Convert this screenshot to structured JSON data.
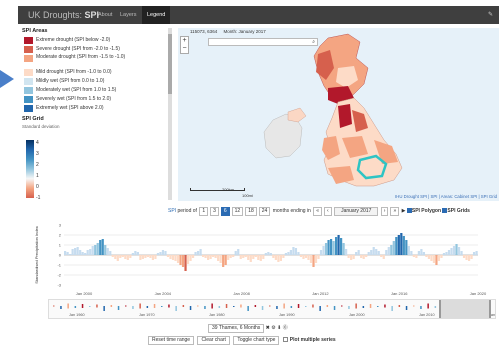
{
  "app": {
    "brand_prefix": "UK Droughts:",
    "brand_bold": "SPI"
  },
  "nav": {
    "items": [
      "About",
      "Layers",
      "Legend"
    ],
    "active": "Legend"
  },
  "legend": {
    "areas_title": "SPI Areas",
    "areas": [
      {
        "label": "Extreme drought (SPI below -2.0)",
        "color": "#b2182b"
      },
      {
        "label": "Severe drought (SPI from -2.0 to -1.5)",
        "color": "#d6604d"
      },
      {
        "label": "Moderate drought (SPI from -1.5 to -1.0)",
        "color": "#f4a582",
        "tall": true
      },
      {
        "label": "Mild drought (SPI from -1.0 to 0.0)",
        "color": "#fddbc7"
      },
      {
        "label": "Mildly wet (SPI from 0.0 to 1.0)",
        "color": "#d1e5f0"
      },
      {
        "label": "Moderately wet (SPI from 1.0 to 1.5)",
        "color": "#92c5de"
      },
      {
        "label": "Severely wet (SPI from 1.5 to 2.0)",
        "color": "#4393c3"
      },
      {
        "label": "Extremely wet (SPI above 2.0)",
        "color": "#2166ac"
      }
    ],
    "grid_title": "SPI Grid",
    "grid_subtitle": "Standard deviation",
    "grid_ticks": [
      "4",
      "3",
      "2",
      "1",
      "0",
      "-1"
    ]
  },
  "map": {
    "coords": "115073, 6364",
    "period": "Month: January 2017",
    "zoom_in": "+",
    "zoom_out": "−",
    "search_icon": "search-icon",
    "scale_top": "200km",
    "scale_bottom": "100mi",
    "attribution": "IHU Drought SPI | SPI | Areas: Cabinet SPI | SPI Grid"
  },
  "controls": {
    "spi_label": "SPI",
    "period_label": "period of",
    "periods": [
      "1",
      "3",
      "6",
      "12",
      "18",
      "24"
    ],
    "active_period": "6",
    "months_label": "months ending in",
    "date": "January 2017",
    "nav_buttons": [
      "«",
      "‹",
      "›",
      "»"
    ],
    "play": "▶",
    "spi_polygon": "SPI Polygon",
    "spi_grids": "SPI Grids"
  },
  "chart_data": {
    "type": "bar",
    "ylabel": "Standardised Precipitation Index",
    "ylim": [
      -3,
      3
    ],
    "x_ticks": [
      "Jan 2000",
      "Jan 2004",
      "Jan 2008",
      "Jan 2012",
      "Jan 2016",
      "Jan 2020"
    ],
    "right_ticks": [],
    "values": [
      0.4,
      0.3,
      0.1,
      0.6,
      0.7,
      0.8,
      0.5,
      0.3,
      0.2,
      0.5,
      0.6,
      0.9,
      1.0,
      1.2,
      1.5,
      1.6,
      1.0,
      0.7,
      0.4,
      -0.2,
      -0.4,
      -0.6,
      -0.3,
      -0.2,
      -0.4,
      -0.5,
      -0.3,
      0.2,
      0.4,
      0.3,
      -0.5,
      -0.4,
      -0.3,
      -0.2,
      -0.3,
      -0.5,
      -0.4,
      0.2,
      0.3,
      0.5,
      0.4,
      -0.2,
      -0.4,
      -0.5,
      -0.6,
      -0.8,
      -1.0,
      -1.2,
      -1.6,
      -0.9,
      -0.6,
      -0.3,
      0.3,
      0.4,
      0.6,
      -0.2,
      -0.3,
      -0.5,
      -0.4,
      -0.2,
      -0.3,
      -0.6,
      -0.8,
      -1.2,
      -1.0,
      -0.5,
      -0.3,
      -0.2,
      0.4,
      0.6,
      -0.4,
      -0.3,
      -0.2,
      -0.5,
      -0.7,
      -0.4,
      -0.2,
      -0.5,
      -0.6,
      -0.4,
      0.2,
      0.3,
      0.2,
      -0.3,
      -0.5,
      -0.7,
      -0.6,
      -0.3,
      0.2,
      0.3,
      0.5,
      0.8,
      0.7,
      0.3,
      -0.2,
      -0.4,
      -0.3,
      -0.5,
      -0.8,
      -1.2,
      -0.8,
      -0.4,
      0.5,
      0.9,
      1.2,
      1.5,
      1.6,
      1.4,
      1.8,
      2.0,
      1.7,
      1.2,
      0.6,
      -0.3,
      -0.5,
      -0.4,
      0.3,
      0.5,
      -0.3,
      -0.4,
      -0.2,
      0.3,
      0.5,
      0.8,
      0.6,
      0.4,
      -0.2,
      -0.4,
      0.5,
      0.8,
      1.0,
      1.4,
      1.8,
      2.0,
      2.2,
      1.9,
      1.5,
      0.9,
      0.4,
      -0.2,
      -0.3,
      0.4,
      0.6,
      0.3,
      -0.2,
      -0.4,
      -0.6,
      -0.8,
      -1.0,
      -0.6,
      -0.3,
      0.2,
      0.3,
      0.5,
      0.7,
      0.9,
      1.1,
      0.8,
      0.4,
      -0.3,
      -0.5,
      -0.6,
      -0.4,
      0.3,
      0.4
    ]
  },
  "navigator": {
    "ticks": [
      "Jan 1960",
      "Jan 1970",
      "Jan 1980",
      "Jan 1990",
      "Jan 2000",
      "Jan 2010",
      "Jan 2020"
    ]
  },
  "series": {
    "name": "39 Thames, 6 Months"
  },
  "bottom": {
    "reset": "Reset time range",
    "clear": "Clear chart",
    "toggle": "Toggle chart type",
    "plot_multiple": "Plot multiple series"
  }
}
